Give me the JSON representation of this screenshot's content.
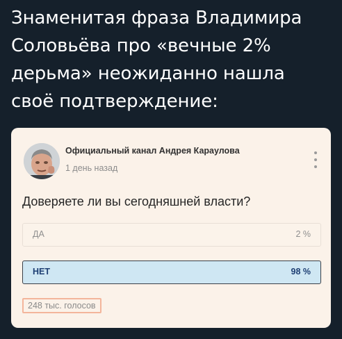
{
  "headline": {
    "lines": [
      "Знаменитая фраза Владимира",
      "Соловьёва про «вечные 2%",
      "дерьма» неожиданно нашла",
      "своё подтверждение:"
    ]
  },
  "post": {
    "channel_name": "Официальный канал Андрея Караулова",
    "time_ago": "1 день назад",
    "avatar_icon": "person-photo-icon",
    "menu_icon": "more-vertical-icon"
  },
  "poll": {
    "question": "Доверяете ли вы сегодняшней власти?",
    "options": [
      {
        "label": "ДА",
        "percent": "2 %",
        "value": 2,
        "selected": false
      },
      {
        "label": "НЕТ",
        "percent": "98 %",
        "value": 98,
        "selected": true
      }
    ],
    "votes_count": "248 тыс. голосов"
  },
  "colors": {
    "page_background": "#15202b",
    "card_background": "#fbf2e9",
    "selected_option_fill": "#cfe7f3",
    "selected_option_text": "#1e3f73",
    "highlight_border": "#f3b59b"
  }
}
